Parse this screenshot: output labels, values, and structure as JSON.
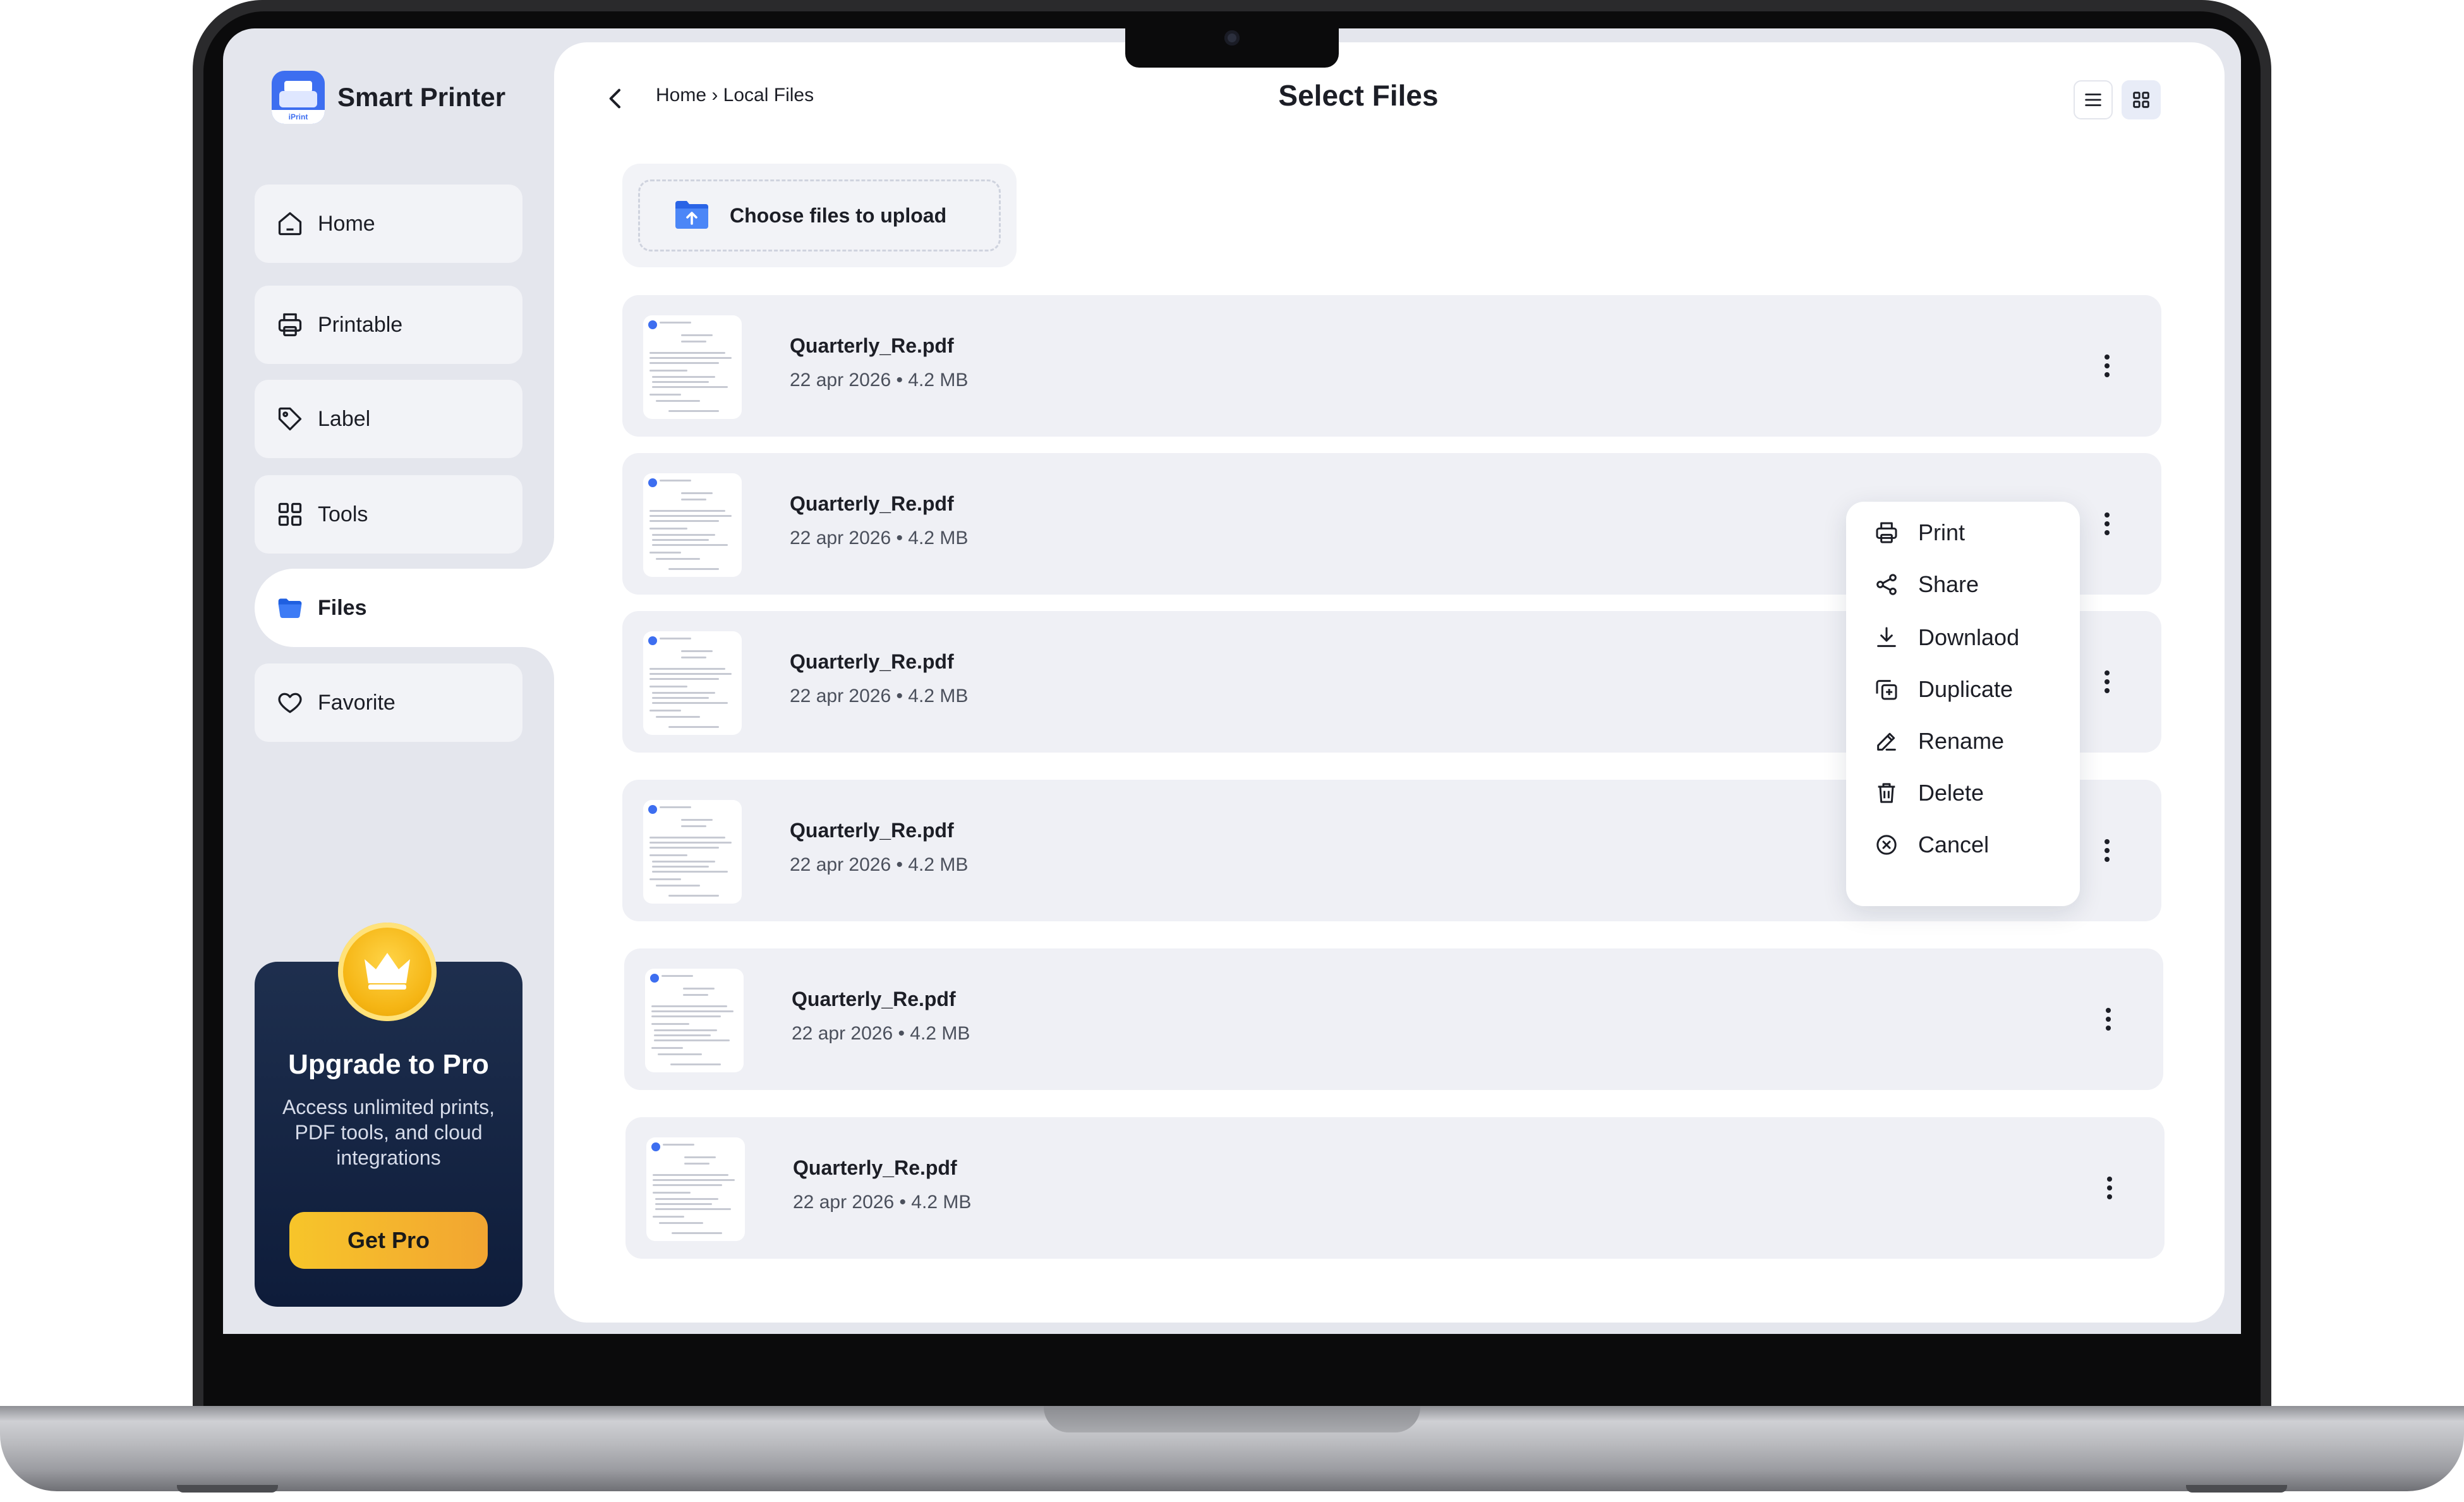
{
  "app": {
    "name": "Smart Printer",
    "logo_caption": "iPrint"
  },
  "sidebar": {
    "items": [
      {
        "label": "Home",
        "icon": "home-icon"
      },
      {
        "label": "Printable",
        "icon": "printer-icon"
      },
      {
        "label": "Label",
        "icon": "tag-icon"
      },
      {
        "label": "Tools",
        "icon": "grid-icon"
      },
      {
        "label": "Files",
        "icon": "folder-icon",
        "active": true
      },
      {
        "label": "Favorite",
        "icon": "heart-icon"
      }
    ],
    "pro": {
      "title": "Upgrade to Pro",
      "description": "Access unlimited prints, PDF tools, and cloud integrations",
      "button": "Get Pro"
    }
  },
  "header": {
    "breadcrumb": "Home › Local Files",
    "title": "Select Files",
    "view_mode": "grid"
  },
  "upload": {
    "label": "Choose files to upload"
  },
  "files": [
    {
      "name": "Quarterly_Re.pdf",
      "date": "22 apr 2026",
      "size": "4.2 MB",
      "meta": "22 apr 2026  •  4.2 MB"
    },
    {
      "name": "Quarterly_Re.pdf",
      "date": "22 apr 2026",
      "size": "4.2 MB",
      "meta": "22 apr 2026  •  4.2 MB"
    },
    {
      "name": "Quarterly_Re.pdf",
      "date": "22 apr 2026",
      "size": "4.2 MB",
      "meta": "22 apr 2026  •  4.2 MB"
    },
    {
      "name": "Quarterly_Re.pdf",
      "date": "22 apr 2026",
      "size": "4.2 MB",
      "meta": "22 apr 2026  •  4.2 MB"
    },
    {
      "name": "Quarterly_Re.pdf",
      "date": "22 apr 2026",
      "size": "4.2 MB",
      "meta": "22 apr 2026  •  4.2 MB"
    },
    {
      "name": "Quarterly_Re.pdf",
      "date": "22 apr 2026",
      "size": "4.2 MB",
      "meta": "22 apr 2026  •  4.2 MB"
    }
  ],
  "context_menu": {
    "items": [
      {
        "label": "Print",
        "icon": "printer-icon"
      },
      {
        "label": "Share",
        "icon": "share-icon"
      },
      {
        "label": "Downlaod",
        "icon": "download-icon"
      },
      {
        "label": "Duplicate",
        "icon": "duplicate-icon"
      },
      {
        "label": "Rename",
        "icon": "edit-icon"
      },
      {
        "label": "Delete",
        "icon": "trash-icon"
      },
      {
        "label": "Cancel",
        "icon": "cancel-icon"
      }
    ]
  },
  "colors": {
    "accent": "#3d6ef0",
    "sidebar_bg": "#e4e6ed",
    "pro_card": "#14254a",
    "pro_button": "#f4b92c"
  }
}
